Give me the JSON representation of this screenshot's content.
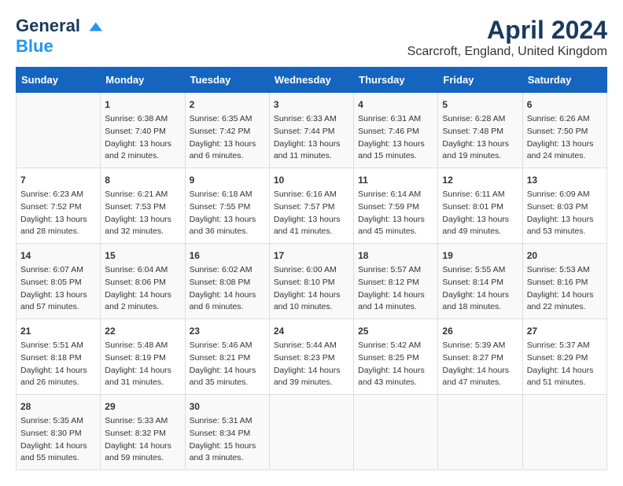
{
  "header": {
    "logo_line1": "General",
    "logo_line2": "Blue",
    "month": "April 2024",
    "location": "Scarcroft, England, United Kingdom"
  },
  "days_of_week": [
    "Sunday",
    "Monday",
    "Tuesday",
    "Wednesday",
    "Thursday",
    "Friday",
    "Saturday"
  ],
  "weeks": [
    [
      {
        "day": "",
        "info": ""
      },
      {
        "day": "1",
        "info": "Sunrise: 6:38 AM\nSunset: 7:40 PM\nDaylight: 13 hours\nand 2 minutes."
      },
      {
        "day": "2",
        "info": "Sunrise: 6:35 AM\nSunset: 7:42 PM\nDaylight: 13 hours\nand 6 minutes."
      },
      {
        "day": "3",
        "info": "Sunrise: 6:33 AM\nSunset: 7:44 PM\nDaylight: 13 hours\nand 11 minutes."
      },
      {
        "day": "4",
        "info": "Sunrise: 6:31 AM\nSunset: 7:46 PM\nDaylight: 13 hours\nand 15 minutes."
      },
      {
        "day": "5",
        "info": "Sunrise: 6:28 AM\nSunset: 7:48 PM\nDaylight: 13 hours\nand 19 minutes."
      },
      {
        "day": "6",
        "info": "Sunrise: 6:26 AM\nSunset: 7:50 PM\nDaylight: 13 hours\nand 24 minutes."
      }
    ],
    [
      {
        "day": "7",
        "info": "Sunrise: 6:23 AM\nSunset: 7:52 PM\nDaylight: 13 hours\nand 28 minutes."
      },
      {
        "day": "8",
        "info": "Sunrise: 6:21 AM\nSunset: 7:53 PM\nDaylight: 13 hours\nand 32 minutes."
      },
      {
        "day": "9",
        "info": "Sunrise: 6:18 AM\nSunset: 7:55 PM\nDaylight: 13 hours\nand 36 minutes."
      },
      {
        "day": "10",
        "info": "Sunrise: 6:16 AM\nSunset: 7:57 PM\nDaylight: 13 hours\nand 41 minutes."
      },
      {
        "day": "11",
        "info": "Sunrise: 6:14 AM\nSunset: 7:59 PM\nDaylight: 13 hours\nand 45 minutes."
      },
      {
        "day": "12",
        "info": "Sunrise: 6:11 AM\nSunset: 8:01 PM\nDaylight: 13 hours\nand 49 minutes."
      },
      {
        "day": "13",
        "info": "Sunrise: 6:09 AM\nSunset: 8:03 PM\nDaylight: 13 hours\nand 53 minutes."
      }
    ],
    [
      {
        "day": "14",
        "info": "Sunrise: 6:07 AM\nSunset: 8:05 PM\nDaylight: 13 hours\nand 57 minutes."
      },
      {
        "day": "15",
        "info": "Sunrise: 6:04 AM\nSunset: 8:06 PM\nDaylight: 14 hours\nand 2 minutes."
      },
      {
        "day": "16",
        "info": "Sunrise: 6:02 AM\nSunset: 8:08 PM\nDaylight: 14 hours\nand 6 minutes."
      },
      {
        "day": "17",
        "info": "Sunrise: 6:00 AM\nSunset: 8:10 PM\nDaylight: 14 hours\nand 10 minutes."
      },
      {
        "day": "18",
        "info": "Sunrise: 5:57 AM\nSunset: 8:12 PM\nDaylight: 14 hours\nand 14 minutes."
      },
      {
        "day": "19",
        "info": "Sunrise: 5:55 AM\nSunset: 8:14 PM\nDaylight: 14 hours\nand 18 minutes."
      },
      {
        "day": "20",
        "info": "Sunrise: 5:53 AM\nSunset: 8:16 PM\nDaylight: 14 hours\nand 22 minutes."
      }
    ],
    [
      {
        "day": "21",
        "info": "Sunrise: 5:51 AM\nSunset: 8:18 PM\nDaylight: 14 hours\nand 26 minutes."
      },
      {
        "day": "22",
        "info": "Sunrise: 5:48 AM\nSunset: 8:19 PM\nDaylight: 14 hours\nand 31 minutes."
      },
      {
        "day": "23",
        "info": "Sunrise: 5:46 AM\nSunset: 8:21 PM\nDaylight: 14 hours\nand 35 minutes."
      },
      {
        "day": "24",
        "info": "Sunrise: 5:44 AM\nSunset: 8:23 PM\nDaylight: 14 hours\nand 39 minutes."
      },
      {
        "day": "25",
        "info": "Sunrise: 5:42 AM\nSunset: 8:25 PM\nDaylight: 14 hours\nand 43 minutes."
      },
      {
        "day": "26",
        "info": "Sunrise: 5:39 AM\nSunset: 8:27 PM\nDaylight: 14 hours\nand 47 minutes."
      },
      {
        "day": "27",
        "info": "Sunrise: 5:37 AM\nSunset: 8:29 PM\nDaylight: 14 hours\nand 51 minutes."
      }
    ],
    [
      {
        "day": "28",
        "info": "Sunrise: 5:35 AM\nSunset: 8:30 PM\nDaylight: 14 hours\nand 55 minutes."
      },
      {
        "day": "29",
        "info": "Sunrise: 5:33 AM\nSunset: 8:32 PM\nDaylight: 14 hours\nand 59 minutes."
      },
      {
        "day": "30",
        "info": "Sunrise: 5:31 AM\nSunset: 8:34 PM\nDaylight: 15 hours\nand 3 minutes."
      },
      {
        "day": "",
        "info": ""
      },
      {
        "day": "",
        "info": ""
      },
      {
        "day": "",
        "info": ""
      },
      {
        "day": "",
        "info": ""
      }
    ]
  ]
}
